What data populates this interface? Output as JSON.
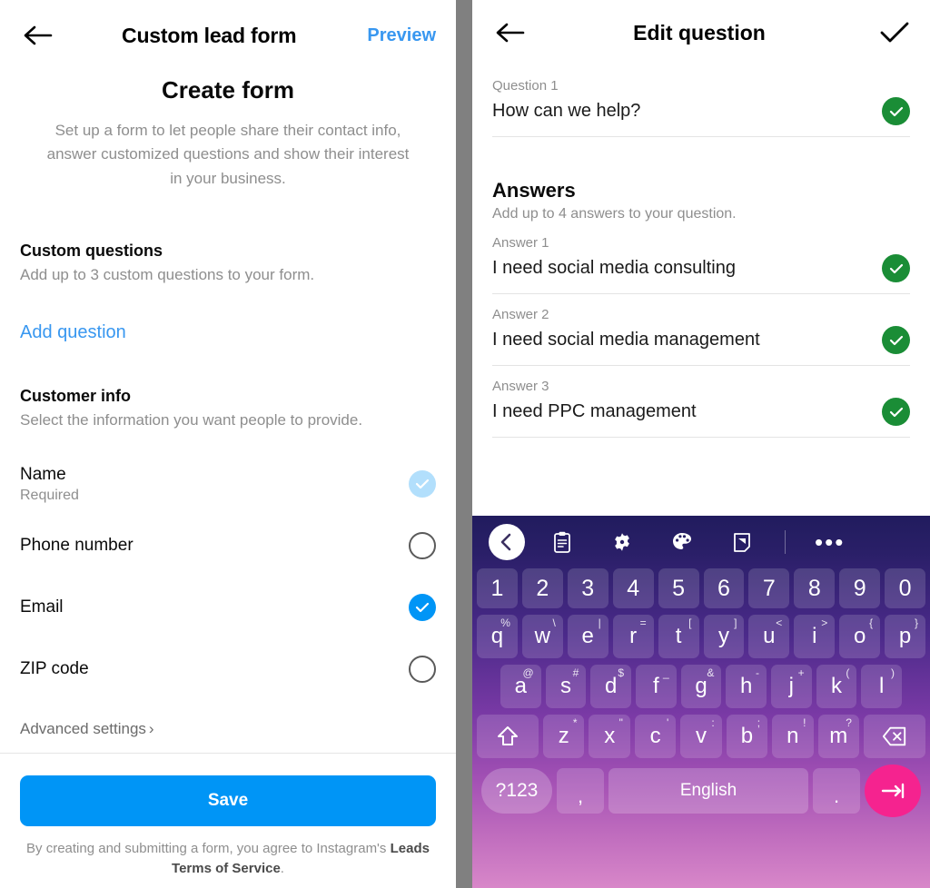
{
  "left": {
    "header": {
      "back_icon": "back-arrow-icon",
      "title": "Custom lead form",
      "preview_label": "Preview"
    },
    "create_title": "Create form",
    "create_desc": "Set up a form to let people share their contact info, answer customized questions and show their interest in your business.",
    "custom_questions": {
      "heading": "Custom questions",
      "subtext": "Add up to 3 custom questions to your form.",
      "add_label": "Add question"
    },
    "customer_info": {
      "heading": "Customer info",
      "subtext": "Select the information you want people to provide.",
      "rows": [
        {
          "label": "Name",
          "sub": "Required",
          "state": "dim"
        },
        {
          "label": "Phone number",
          "sub": "",
          "state": "off"
        },
        {
          "label": "Email",
          "sub": "",
          "state": "on"
        },
        {
          "label": "ZIP code",
          "sub": "",
          "state": "off"
        }
      ]
    },
    "advanced_settings": "Advanced settings",
    "advanced_chevron": "›",
    "save_label": "Save",
    "tos_prefix": "By creating and submitting a form, you agree to Instagram's ",
    "tos_link": "Leads Terms of Service",
    "tos_suffix": "."
  },
  "right": {
    "header": {
      "back_icon": "back-arrow-icon",
      "title": "Edit question",
      "done_icon": "checkmark-icon"
    },
    "question": {
      "label": "Question 1",
      "value": "How can we help?"
    },
    "answers_section": {
      "title": "Answers",
      "subtext": "Add up to 4 answers to your question."
    },
    "answers": [
      {
        "label": "Answer 1",
        "value": "I need social media consulting"
      },
      {
        "label": "Answer 2",
        "value": "I need social media management"
      },
      {
        "label": "Answer 3",
        "value": "I need PPC management"
      }
    ]
  },
  "keyboard": {
    "toolbar": [
      {
        "name": "back-chevron-icon",
        "glyph": "chevron-left"
      },
      {
        "name": "clipboard-icon",
        "glyph": "clipboard"
      },
      {
        "name": "gear-icon",
        "glyph": "gear"
      },
      {
        "name": "palette-icon",
        "glyph": "palette"
      },
      {
        "name": "resize-keyboard-icon",
        "glyph": "resize"
      },
      {
        "name": "more-options-icon",
        "glyph": "dots"
      }
    ],
    "row_numbers": [
      "1",
      "2",
      "3",
      "4",
      "5",
      "6",
      "7",
      "8",
      "9",
      "0"
    ],
    "row_qwerty": [
      {
        "key": "q",
        "sup": "%"
      },
      {
        "key": "w",
        "sup": "\\"
      },
      {
        "key": "e",
        "sup": "|"
      },
      {
        "key": "r",
        "sup": "="
      },
      {
        "key": "t",
        "sup": "["
      },
      {
        "key": "y",
        "sup": "]"
      },
      {
        "key": "u",
        "sup": "<"
      },
      {
        "key": "i",
        "sup": ">"
      },
      {
        "key": "o",
        "sup": "{"
      },
      {
        "key": "p",
        "sup": "}"
      }
    ],
    "row_asdf": [
      {
        "key": "a",
        "sup": "@"
      },
      {
        "key": "s",
        "sup": "#"
      },
      {
        "key": "d",
        "sup": "$"
      },
      {
        "key": "f",
        "sup": "_"
      },
      {
        "key": "g",
        "sup": "&"
      },
      {
        "key": "h",
        "sup": "-"
      },
      {
        "key": "j",
        "sup": "+"
      },
      {
        "key": "k",
        "sup": "("
      },
      {
        "key": "l",
        "sup": ")"
      }
    ],
    "row_zxcv": [
      {
        "key": "z",
        "sup": "*"
      },
      {
        "key": "x",
        "sup": "\""
      },
      {
        "key": "c",
        "sup": "'"
      },
      {
        "key": "v",
        "sup": ":"
      },
      {
        "key": "b",
        "sup": ";"
      },
      {
        "key": "n",
        "sup": "!"
      },
      {
        "key": "m",
        "sup": "?"
      }
    ],
    "shift_icon": "shift-icon",
    "backspace_icon": "backspace-icon",
    "symbols_label": "?123",
    "comma_label": ",",
    "space_label": "English",
    "period_label": ".",
    "enter_icon": "enter-icon"
  },
  "colors": {
    "accent_blue": "#0095f6",
    "link_blue": "#3897f0",
    "green": "#1a8d36",
    "pink": "#f5238f",
    "divider_gray": "#808080"
  }
}
